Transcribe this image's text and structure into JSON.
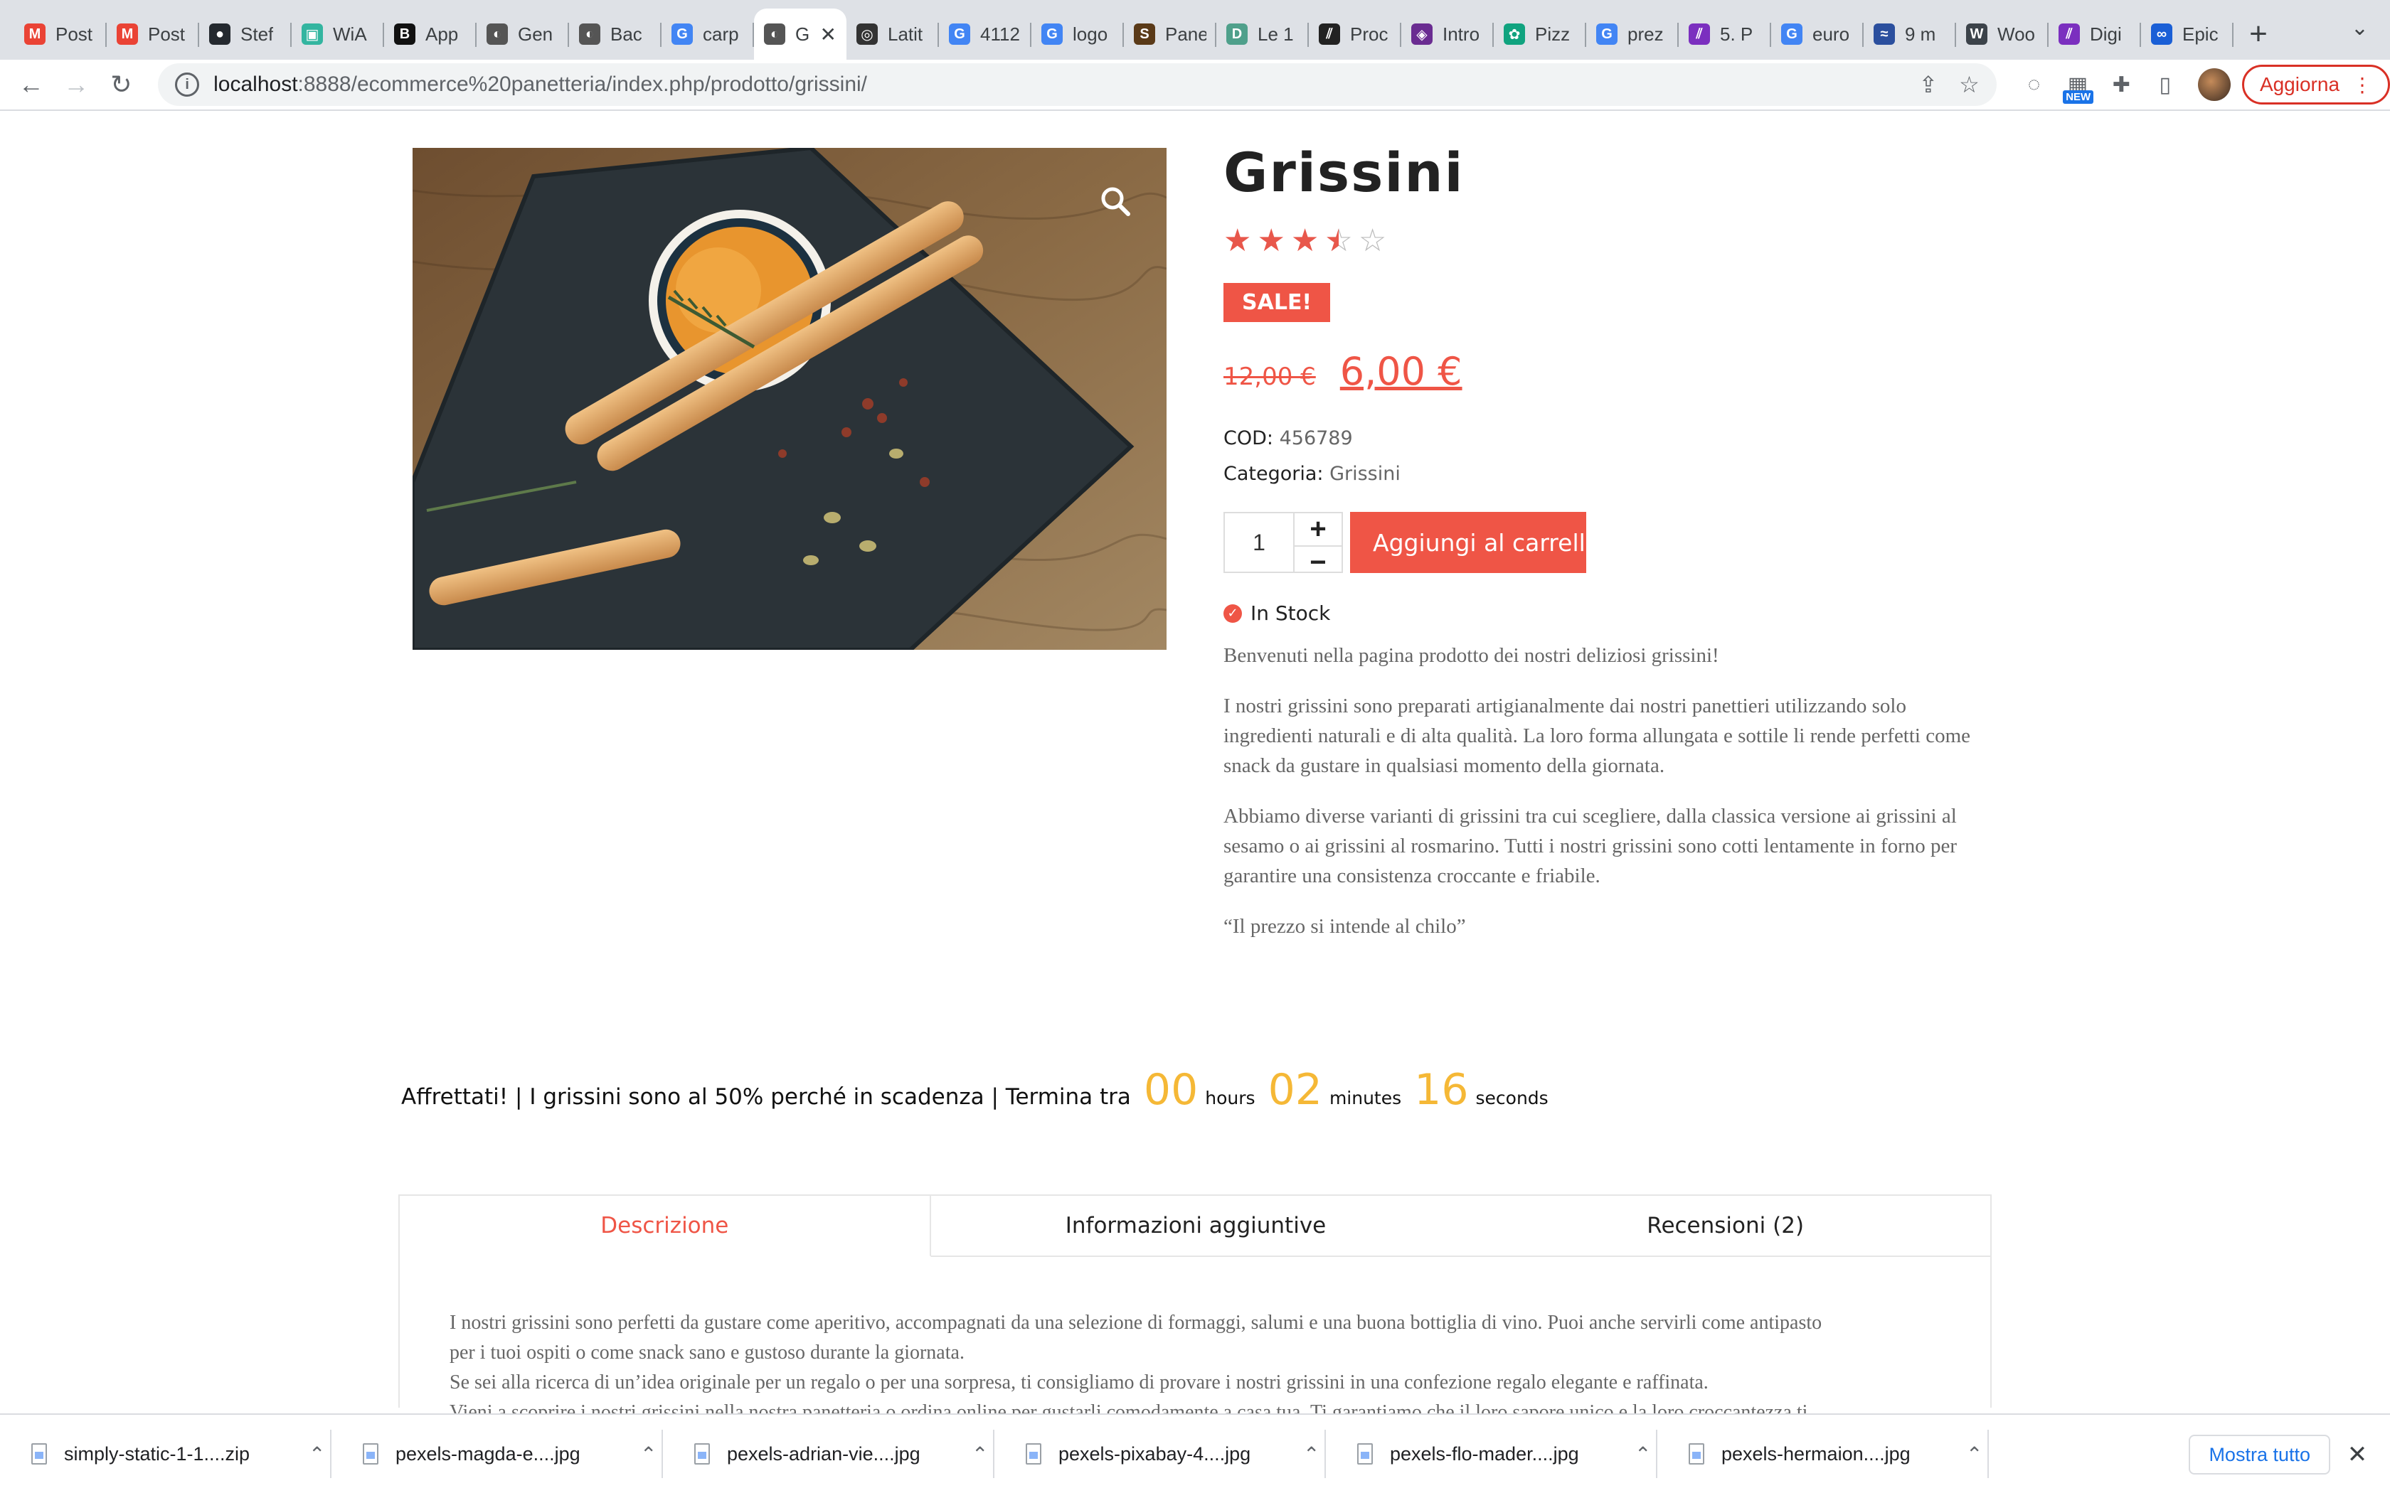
{
  "browser": {
    "tabs": [
      {
        "title": "Post",
        "icon": "gmail-icon",
        "color": "#ea4335"
      },
      {
        "title": "Post",
        "icon": "gmail-icon",
        "color": "#ea4335"
      },
      {
        "title": "Stef",
        "icon": "github-icon",
        "color": "#24292f"
      },
      {
        "title": "WiA",
        "icon": "wia-icon",
        "color": "#33b5a0"
      },
      {
        "title": "App",
        "icon": "b-icon",
        "color": "#111111"
      },
      {
        "title": "Gen",
        "icon": "site-icon",
        "color": "#555555"
      },
      {
        "title": "Bac",
        "icon": "site-icon",
        "color": "#555555"
      },
      {
        "title": "carp",
        "icon": "google-icon",
        "color": "#4285f4"
      },
      {
        "title": "G",
        "icon": "site-icon",
        "color": "#555555",
        "active": true
      },
      {
        "title": "Latit",
        "icon": "compass-icon",
        "color": "#333333"
      },
      {
        "title": "4112",
        "icon": "google-icon",
        "color": "#4285f4"
      },
      {
        "title": "logo",
        "icon": "google-icon",
        "color": "#4285f4"
      },
      {
        "title": "Pane",
        "icon": "s-icon",
        "color": "#5a3a18"
      },
      {
        "title": "Le 1",
        "icon": "d-icon",
        "color": "#4fa08b"
      },
      {
        "title": "Proc",
        "icon": "stripes-icon",
        "color": "#222222"
      },
      {
        "title": "Intro",
        "icon": "intro-icon",
        "color": "#6a2c91"
      },
      {
        "title": "Pizz",
        "icon": "openai-icon",
        "color": "#10a37f"
      },
      {
        "title": "prez",
        "icon": "google-icon",
        "color": "#4285f4"
      },
      {
        "title": "5. P",
        "icon": "slash-icon",
        "color": "#7b2fbf"
      },
      {
        "title": "euro",
        "icon": "google-icon",
        "color": "#4285f4"
      },
      {
        "title": "9 m",
        "icon": "wave-icon",
        "color": "#2b4f9e"
      },
      {
        "title": "Woo",
        "icon": "wordpress-icon",
        "color": "#3c434a"
      },
      {
        "title": "Digi",
        "icon": "slash-icon",
        "color": "#7b2fbf"
      },
      {
        "title": "Epic",
        "icon": "epic-icon",
        "color": "#1a5fd6"
      }
    ],
    "url": "localhost:8888/ecommerce%20panetteria/index.php/prodotto/grissini/",
    "url_host": "localhost",
    "url_path": ":8888/ecommerce%20panetteria/index.php/prodotto/grissini/",
    "extension_badge": "NEW",
    "update_label": "Aggiorna"
  },
  "product": {
    "title": "Grissini",
    "rating": 3.5,
    "rating_max": 5,
    "sale_badge": "SALE!",
    "price_old": "12,00 €",
    "price_new": "6,00 €",
    "sku_label": "COD:",
    "sku": "456789",
    "category_label": "Categoria:",
    "category": "Grissini",
    "quantity": "1",
    "add_to_cart": "Aggiungi al carrello",
    "stock": "In Stock",
    "description": [
      "Benvenuti nella pagina prodotto dei nostri deliziosi grissini!",
      "I nostri grissini sono preparati artigianalmente dai nostri panettieri utilizzando solo ingredienti naturali e di alta qualità. La loro forma allungata e sottile li rende perfetti come snack da gustare in qualsiasi momento della giornata.",
      "Abbiamo diverse varianti di grissini tra cui scegliere, dalla classica versione ai grissini al sesamo o ai grissini al rosmarino. Tutti i nostri grissini sono cotti lentamente in forno per garantire una consistenza croccante e friabile.",
      "“Il prezzo si intende al chilo”"
    ]
  },
  "countdown": {
    "text": "Affrettati! | I grissini sono al 50% perché in scadenza | Termina tra",
    "hours": "00",
    "hours_label": "hours",
    "minutes": "02",
    "minutes_label": "minutes",
    "seconds": "16",
    "seconds_label": "seconds"
  },
  "tabs": {
    "items": [
      "Descrizione",
      "Informazioni aggiuntive",
      "Recensioni (2)"
    ],
    "active": "Descrizione",
    "content_lines": [
      "I nostri grissini sono perfetti da gustare come aperitivo, accompagnati da una selezione di formaggi, salumi e una buona bottiglia di vino. Puoi anche servirli come antipasto",
      "per i tuoi ospiti o come snack sano e gustoso durante la giornata.",
      "Se sei alla ricerca di un’idea originale per un regalo o per una sorpresa, ti consigliamo di provare i nostri grissini in una confezione regalo elegante e raffinata.",
      "Vieni a scoprire i nostri grissini nella nostra panetteria o ordina online per gustarli comodamente a casa tua. Ti garantiamo che il loro sapore unico e la loro croccantezza ti"
    ]
  },
  "downloads": {
    "items": [
      "simply-static-1-1....zip",
      "pexels-magda-e....jpg",
      "pexels-adrian-vie....jpg",
      "pexels-pixabay-4....jpg",
      "pexels-flo-mader....jpg",
      "pexels-hermaion....jpg"
    ],
    "show_all": "Mostra tutto"
  },
  "colors": {
    "accent": "#ef5546",
    "countdown_numbers": "#f5b836",
    "link_blue": "#1a73e8"
  }
}
